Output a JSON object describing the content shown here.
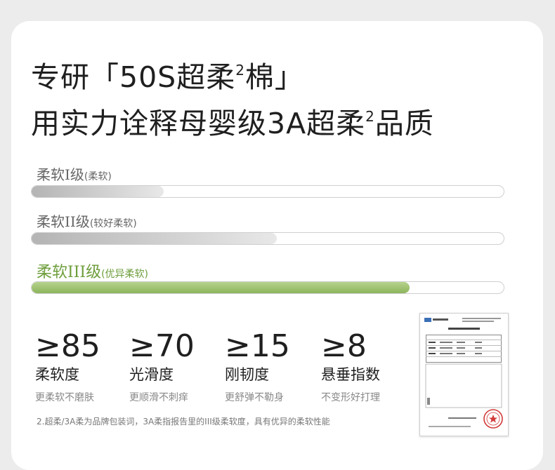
{
  "headline": {
    "line1_pre": "专研「50S超柔",
    "line1_sup": "2",
    "line1_post": "棉」",
    "line2_pre": "用实力诠释母婴级3A超柔",
    "line2_sup": "2",
    "line2_post": "品质"
  },
  "levels": [
    {
      "name": "柔软I级",
      "note": "(柔软)",
      "fill": 0.28,
      "color": "#b4b4b4"
    },
    {
      "name": "柔软II级",
      "note": "(较好柔软)",
      "fill": 0.52,
      "color": "#b4b4b4"
    },
    {
      "name": "柔软III级",
      "note": "(优异柔软)",
      "fill": 0.8,
      "color": "#8db45c"
    }
  ],
  "stats": [
    {
      "value": "≥85",
      "title": "柔软度",
      "desc": "更柔软不磨肤"
    },
    {
      "value": "≥70",
      "title": "光滑度",
      "desc": "更顺滑不刺痒"
    },
    {
      "value": "≥15",
      "title": "刚韧度",
      "desc": "更舒弹不勒身"
    },
    {
      "value": "≥8",
      "title": "悬垂指数",
      "desc": "不变形好打理"
    }
  ],
  "footnote": "2.超柔/3A柔为品牌包装词，3A柔指报告里的III级柔软度，具有优异的柔软性能",
  "colors": {
    "accent_green": "#8db45c",
    "label_green": "#6e9e3c",
    "seal_red": "#d33a3a"
  }
}
